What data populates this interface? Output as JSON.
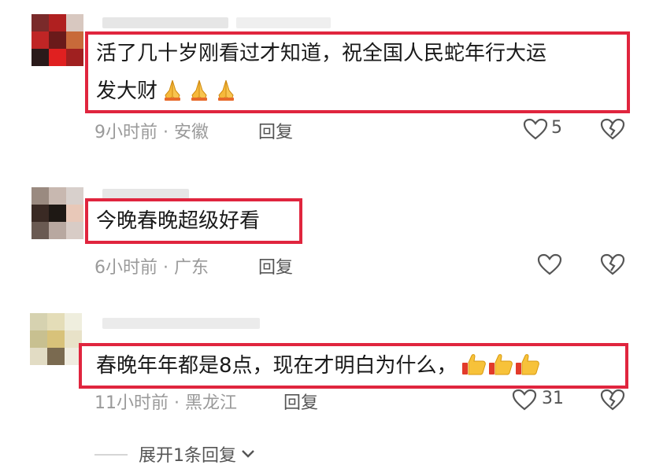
{
  "comments": [
    {
      "text_line1": "活了几十岁刚看过才知道，祝全国人民蛇年行大运",
      "text_line2": "发大财",
      "emoji": "folded-hands",
      "time_location": "9小时前 · 安徽",
      "reply_label": "回复",
      "likes": "5"
    },
    {
      "text": "今晚春晚超级好看",
      "time_location": "6小时前 · 广东",
      "reply_label": "回复",
      "likes": ""
    },
    {
      "text": "春晚年年都是8点，现在才明白为什么，",
      "emoji": "thumbs-up",
      "time_location": "11小时前 · 黑龙江",
      "reply_label": "回复",
      "likes": "31"
    }
  ],
  "expand_replies": "展开1条回复",
  "colors": {
    "highlight_border": "#e0253e",
    "meta_text": "#9a9a9a",
    "action_text": "#555555"
  }
}
